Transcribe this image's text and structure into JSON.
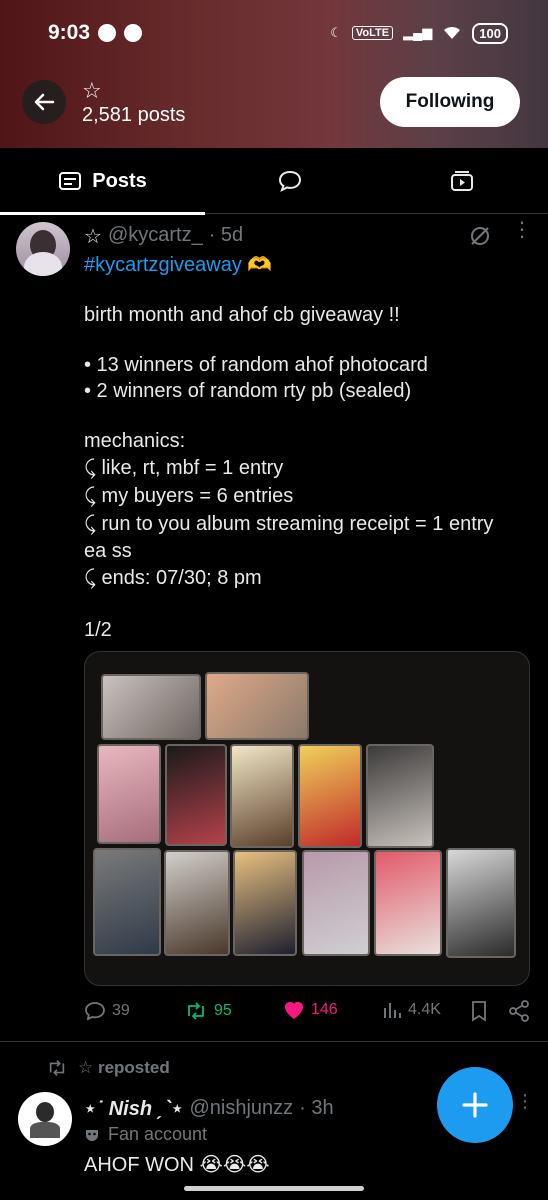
{
  "status_bar": {
    "time": "9:03",
    "network": "VoLTE",
    "battery": "100"
  },
  "profile": {
    "name": "☆",
    "posts_count": "2,581 posts",
    "follow_label": "Following"
  },
  "tabs": {
    "posts_label": "Posts"
  },
  "tweet": {
    "star": "☆",
    "handle": "@kycartz_",
    "time": "· 5d",
    "hashtag": "#kycartzgiveaway 🫶",
    "lines": [
      "birth month and ahof cb giveaway !!",
      "• 13 winners of random ahof photocard",
      "• 2 winners of random rty pb (sealed)",
      "mechanics:",
      "⤹ like, rt, mbf = 1 entry",
      "⤹ my buyers = 6 entries",
      "⤹ run to you album streaming receipt = 1 entry",
      "ea ss",
      "⤹ ends: 07/30; 8 pm",
      "1/2"
    ],
    "stats": {
      "replies": "39",
      "reposts": "95",
      "likes": "146",
      "views": "4.4K"
    }
  },
  "repost": {
    "label": "☆ reposted",
    "name": "⋆˙ Nish ˏˋ⋆",
    "handle": "@nishjunzz",
    "time": "· 3h",
    "badge": "Fan account",
    "text": "AHOF WON 😭😭😭"
  },
  "colors": {
    "accent": "#1d9bf0",
    "like": "#f91880",
    "repost": "#00ba7c",
    "muted": "#71767b"
  }
}
